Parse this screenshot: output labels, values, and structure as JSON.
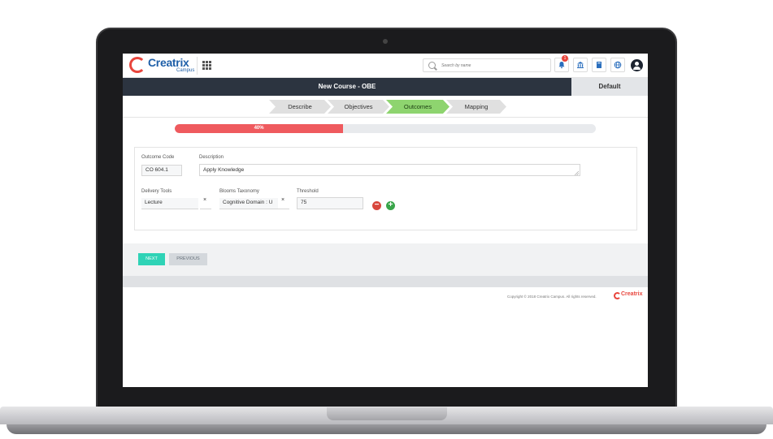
{
  "header": {
    "logo_text": "Creatrix",
    "logo_sub": "Campus",
    "search_placeholder": "Search by name",
    "notification_count": "1"
  },
  "title_bar": {
    "title": "New Course - OBE",
    "default_tab": "Default"
  },
  "steps": [
    {
      "label": "Describe",
      "active": false
    },
    {
      "label": "Objectives",
      "active": false
    },
    {
      "label": "Outcomes",
      "active": true
    },
    {
      "label": "Mapping",
      "active": false
    }
  ],
  "progress": {
    "label": "40%",
    "fraction": 0.4
  },
  "form": {
    "outcome_code_label": "Outcome Code",
    "outcome_code_value": "CO 604.1",
    "description_label": "Description",
    "description_value": "Apply Knowledge",
    "delivery_tools_label": "Delivery Tools",
    "delivery_tools_value": "Lecture",
    "blooms_label": "Blooms Taxonomy",
    "blooms_value": "Cognitive Domain : U",
    "threshold_label": "Threshold",
    "threshold_value": "75",
    "clear_symbol": "×",
    "remove_symbol": "−",
    "add_symbol": "+"
  },
  "actions": {
    "next_label": "NEXT",
    "previous_label": "PREVIOUS"
  },
  "footer": {
    "copyright": "Copyright © 2018 Creatrix Campus. All rights reserved.",
    "logo_text": "Creatrix"
  },
  "colors": {
    "header_dark": "#2c3440",
    "step_active": "#8ed46f",
    "progress_fill": "#ef5a5e",
    "next_button": "#2fd3b6",
    "brand_blue": "#1e5fa8",
    "brand_red": "#e8453c"
  },
  "icons": {
    "apps": "grid-icon",
    "search": "search-icon",
    "notifications": "bell-icon",
    "institution": "bank-icon",
    "library": "book-icon",
    "language": "globe-icon",
    "profile": "user-avatar-icon"
  }
}
